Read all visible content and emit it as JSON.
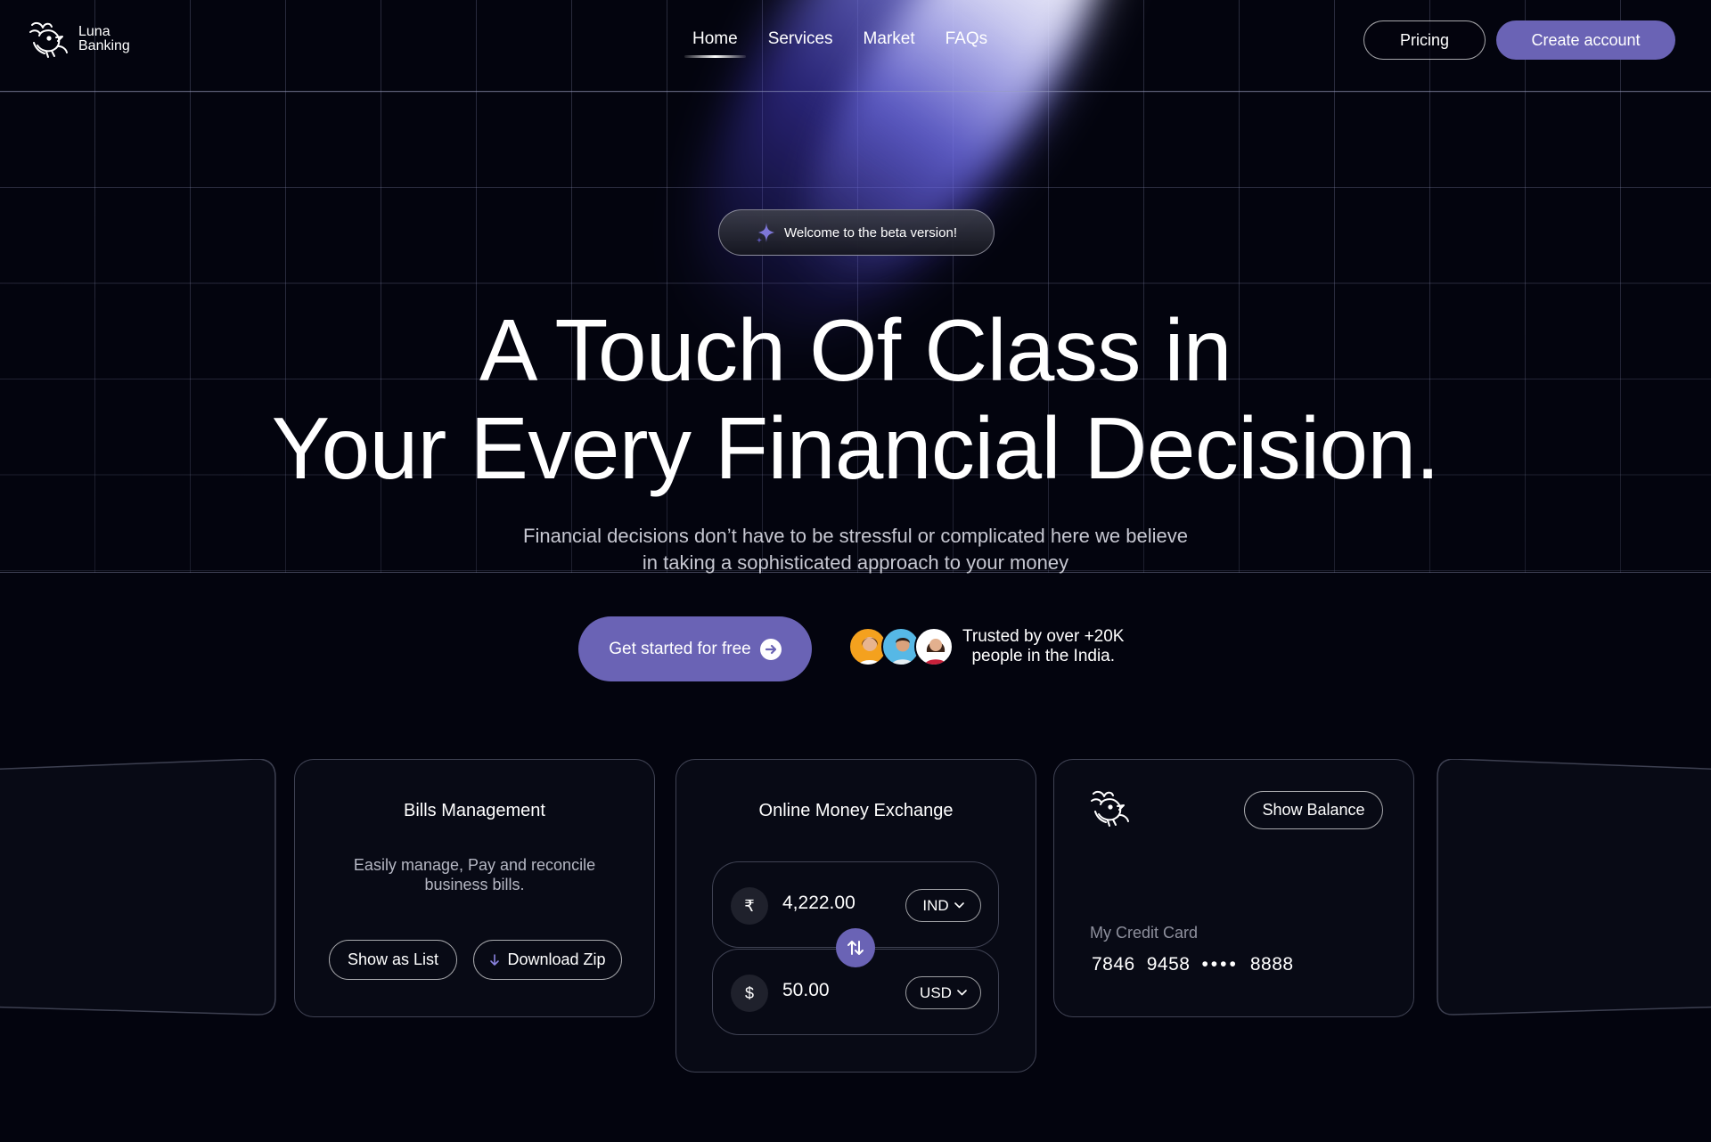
{
  "brand": {
    "line1": "Luna",
    "line2": "Banking"
  },
  "nav": {
    "links": [
      "Home",
      "Services",
      "Market",
      "FAQs"
    ],
    "active": "Home",
    "pricing_label": "Pricing",
    "create_account_label": "Create account"
  },
  "hero": {
    "badge": "Welcome to the beta version!",
    "title_line1": "A Touch Of Class in",
    "title_line2": "Your Every Financial Decision.",
    "subtitle_line1": "Financial decisions don’t have to be stressful or complicated here we believe",
    "subtitle_line2": "in taking a sophisticated approach to your money",
    "cta_label": "Get started for free",
    "trusted_line1": "Trusted by over +20K",
    "trusted_line2": "people in the India."
  },
  "cards": {
    "bills": {
      "title": "Bills Management",
      "desc_line1": "Easily manage, Pay and reconcile",
      "desc_line2": "business bills.",
      "show_list_label": "Show as List",
      "download_label": "Download Zip"
    },
    "exchange": {
      "title": "Online Money Exchange",
      "from": {
        "symbol": "₹",
        "amount": "4,222.00",
        "currency": "IND"
      },
      "to": {
        "symbol": "$",
        "amount": "50.00",
        "currency": "USD"
      }
    },
    "credit": {
      "show_balance_label": "Show Balance",
      "label": "My Credit Card",
      "number_parts": [
        "7846",
        "9458",
        "••••",
        "8888"
      ]
    }
  },
  "colors": {
    "background": "#03040e",
    "accent": "#6a63b5",
    "card_bg": "#080a15"
  }
}
